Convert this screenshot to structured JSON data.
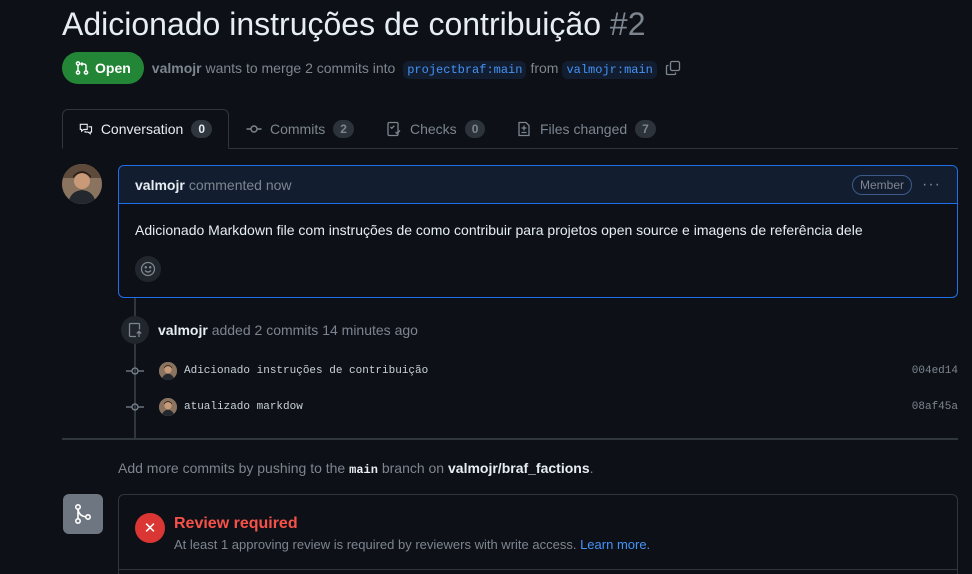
{
  "pr": {
    "title": "Adicionado instruções de contribuição",
    "number": "#2",
    "state": "Open",
    "author": "valmojr",
    "merge_text": "wants to merge 2 commits into",
    "base_branch": "projectbraf:main",
    "from_text": "from",
    "head_branch": "valmojr:main"
  },
  "tabs": [
    {
      "label": "Conversation",
      "count": "0",
      "icon": "comment-discussion-icon"
    },
    {
      "label": "Commits",
      "count": "2",
      "icon": "git-commit-icon"
    },
    {
      "label": "Checks",
      "count": "0",
      "icon": "checklist-icon"
    },
    {
      "label": "Files changed",
      "count": "7",
      "icon": "file-diff-icon"
    }
  ],
  "comment": {
    "author": "valmojr",
    "action": "commented now",
    "role": "Member",
    "menu": "···",
    "body": "Adicionado Markdown file com instruções de como contribuir para projetos open source e imagens de referência dele"
  },
  "push_event": {
    "author": "valmojr",
    "text": "added 2 commits 14 minutes ago"
  },
  "commits": [
    {
      "message": "Adicionado instruções de contribuição",
      "sha": "004ed14"
    },
    {
      "message": "atualizado markdow",
      "sha": "08af45a"
    }
  ],
  "hint": {
    "prefix": "Add more commits by pushing to the",
    "branch": "main",
    "middle": "branch on",
    "repo": "valmojr/braf_factions",
    "suffix": "."
  },
  "review": {
    "title": "Review required",
    "text": "At least 1 approving review is required by reviewers with write access.",
    "link": "Learn more."
  },
  "colors": {
    "background": "#0d1117",
    "open_green": "#238636",
    "link_blue": "#4493f8",
    "error_red": "#f85149",
    "border": "#30363d",
    "accent_border": "#1f6feb"
  }
}
